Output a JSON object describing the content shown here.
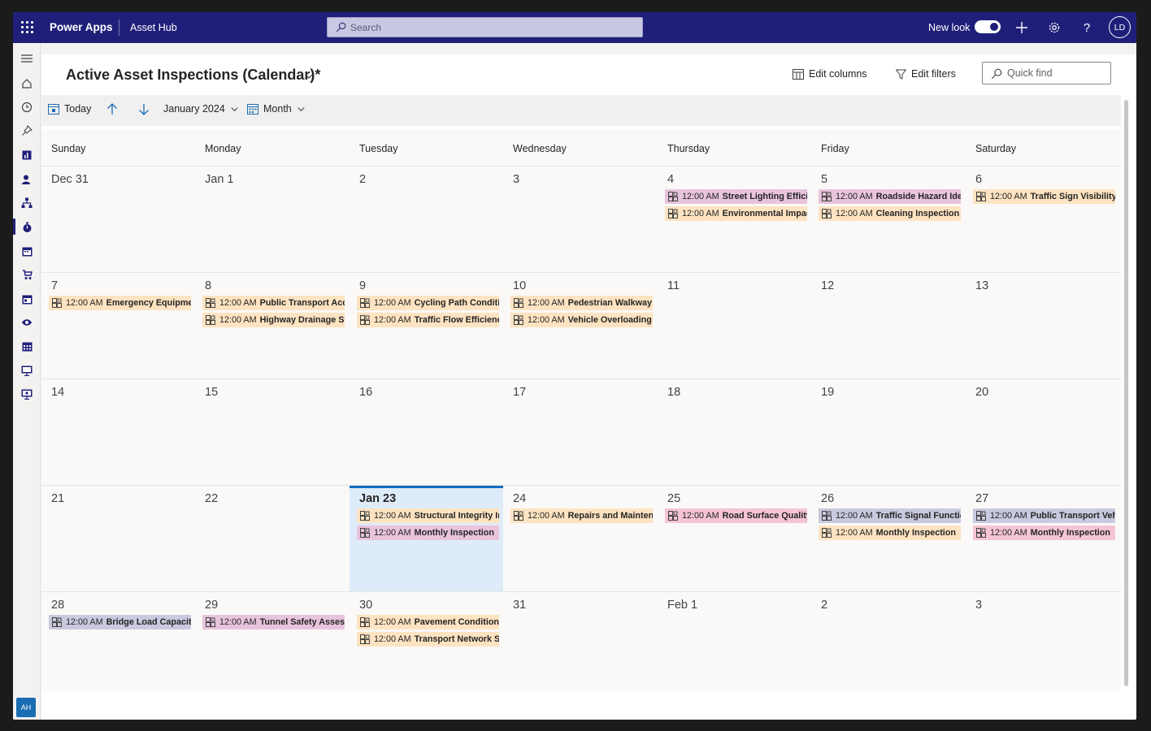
{
  "topbar": {
    "app_name": "Power Apps",
    "environment": "Asset Hub",
    "search_placeholder": "Search",
    "new_look_label": "New look",
    "user_initials": "LD",
    "accent_color": "#1f1f7a"
  },
  "rail": {
    "icons": [
      "hamburger-icon",
      "home-icon",
      "recent-icon",
      "pin-icon",
      "dashboard-icon",
      "contacts-icon",
      "hierarchy-icon",
      "inspection-icon",
      "calendar-icon",
      "stroller-icon",
      "schedule-icon",
      "eye-icon",
      "calendar-grid-icon",
      "monitor-icon",
      "monitor-alt-icon"
    ],
    "active_index": 7,
    "footer_initials": "AH"
  },
  "view": {
    "title": "Active Asset Inspections (Calendar)*",
    "edit_columns_label": "Edit columns",
    "edit_filters_label": "Edit filters",
    "quick_find_placeholder": "Quick find"
  },
  "toolbar": {
    "today_label": "Today",
    "month_year": "January 2024",
    "view_mode": "Month"
  },
  "calendar": {
    "weekdays": [
      "Sunday",
      "Monday",
      "Tuesday",
      "Wednesday",
      "Thursday",
      "Friday",
      "Saturday"
    ],
    "event_colors": {
      "orange": "#fde3c1",
      "pink": "#e8c4dc",
      "purple": "#c9c9df",
      "rose": "#f5c5d4"
    },
    "weeks": [
      [
        {
          "label": "Dec 31",
          "events": []
        },
        {
          "label": "Jan 1",
          "events": []
        },
        {
          "label": "2",
          "events": []
        },
        {
          "label": "3",
          "events": []
        },
        {
          "label": "4",
          "events": [
            {
              "time": "12:00 AM",
              "title": "Street Lighting Efficie",
              "color": "pink"
            },
            {
              "time": "12:00 AM",
              "title": "Environmental Impac",
              "color": "orange"
            }
          ]
        },
        {
          "label": "5",
          "events": [
            {
              "time": "12:00 AM",
              "title": "Roadside Hazard Ider",
              "color": "pink"
            },
            {
              "time": "12:00 AM",
              "title": "Cleaning Inspection",
              "color": "orange"
            }
          ]
        },
        {
          "label": "6",
          "events": [
            {
              "time": "12:00 AM",
              "title": "Traffic Sign Visibility I",
              "color": "orange"
            }
          ]
        }
      ],
      [
        {
          "label": "7",
          "events": [
            {
              "time": "12:00 AM",
              "title": "Emergency Equipmen",
              "color": "orange"
            }
          ]
        },
        {
          "label": "8",
          "events": [
            {
              "time": "12:00 AM",
              "title": "Public Transport Acce",
              "color": "orange"
            },
            {
              "time": "12:00 AM",
              "title": "Highway Drainage Sy",
              "color": "orange"
            }
          ]
        },
        {
          "label": "9",
          "events": [
            {
              "time": "12:00 AM",
              "title": "Cycling Path Conditio",
              "color": "orange"
            },
            {
              "time": "12:00 AM",
              "title": "Traffic Flow Efficiency",
              "color": "orange"
            }
          ]
        },
        {
          "label": "10",
          "events": [
            {
              "time": "12:00 AM",
              "title": "Pedestrian Walkway S",
              "color": "orange"
            },
            {
              "time": "12:00 AM",
              "title": "Vehicle Overloading C",
              "color": "orange"
            }
          ]
        },
        {
          "label": "11",
          "events": []
        },
        {
          "label": "12",
          "events": []
        },
        {
          "label": "13",
          "events": []
        }
      ],
      [
        {
          "label": "14",
          "events": []
        },
        {
          "label": "15",
          "events": []
        },
        {
          "label": "16",
          "events": []
        },
        {
          "label": "17",
          "events": []
        },
        {
          "label": "18",
          "events": []
        },
        {
          "label": "19",
          "events": []
        },
        {
          "label": "20",
          "events": []
        }
      ],
      [
        {
          "label": "21",
          "events": []
        },
        {
          "label": "22",
          "events": []
        },
        {
          "label": "Jan 23",
          "today": true,
          "events": [
            {
              "time": "12:00 AM",
              "title": "Structural Integrity In",
              "color": "orange"
            },
            {
              "time": "12:00 AM",
              "title": "Monthly Inspection",
              "color": "pink"
            }
          ]
        },
        {
          "label": "24",
          "events": [
            {
              "time": "12:00 AM",
              "title": "Repairs and Maintena",
              "color": "orange"
            }
          ]
        },
        {
          "label": "25",
          "events": [
            {
              "time": "12:00 AM",
              "title": "Road Surface Quality",
              "color": "rose"
            }
          ]
        },
        {
          "label": "26",
          "events": [
            {
              "time": "12:00 AM",
              "title": "Traffic Signal Functior",
              "color": "purple"
            },
            {
              "time": "12:00 AM",
              "title": "Monthly Inspection",
              "color": "orange"
            }
          ]
        },
        {
          "label": "27",
          "events": [
            {
              "time": "12:00 AM",
              "title": "Public Transport Vehi",
              "color": "purple"
            },
            {
              "time": "12:00 AM",
              "title": "Monthly Inspection",
              "color": "rose"
            }
          ]
        }
      ],
      [
        {
          "label": "28",
          "events": [
            {
              "time": "12:00 AM",
              "title": "Bridge Load Capacity",
              "color": "purple"
            }
          ]
        },
        {
          "label": "29",
          "events": [
            {
              "time": "12:00 AM",
              "title": "Tunnel Safety Assessr",
              "color": "pink"
            }
          ]
        },
        {
          "label": "30",
          "events": [
            {
              "time": "12:00 AM",
              "title": "Pavement Condition I",
              "color": "orange"
            },
            {
              "time": "12:00 AM",
              "title": "Transport Network Se",
              "color": "orange"
            }
          ]
        },
        {
          "label": "31",
          "events": []
        },
        {
          "label": "Feb 1",
          "events": []
        },
        {
          "label": "2",
          "events": []
        },
        {
          "label": "3",
          "events": []
        }
      ]
    ]
  }
}
